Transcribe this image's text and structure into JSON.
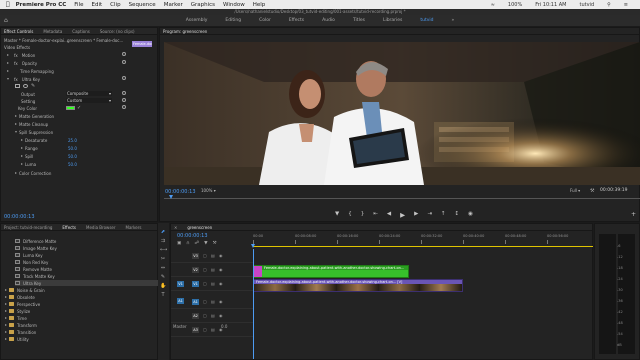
{
  "menubar": {
    "app": "Premiere Pro CC",
    "items": [
      "File",
      "Edit",
      "Clip",
      "Sequence",
      "Marker",
      "Graphics",
      "Window",
      "Help"
    ],
    "status": [
      "100%",
      "Fri 10:11 AM",
      "tutvid"
    ]
  },
  "titlebar": "/Users/nathanielstudio/Desktop/03_tutvid-editing/001-assets/tutvid-recording.prproj *",
  "workspaces": {
    "items": [
      "Assembly",
      "Editing",
      "Color",
      "Effects",
      "Audio",
      "Titles",
      "Libraries",
      "tutvid"
    ],
    "active": "tutvid"
  },
  "effect_controls": {
    "tabs": [
      "Effect Controls",
      "Metadata",
      "Captions",
      "Source: (no clips)"
    ],
    "master": "Master * Female-doctor-explai...",
    "clip": "greenscreen * Female-doc...",
    "clip_badge": "Female-doc",
    "section": "Video Effects",
    "fx": [
      "Motion",
      "Opacity",
      "Time Remapping",
      "Ultra Key"
    ],
    "output_label": "Output",
    "output_value": "Composite",
    "setting_label": "Setting",
    "setting_value": "Custom",
    "keycolor_label": "Key Color",
    "groups": [
      "Matte Generation",
      "Matte Cleanup",
      "Spill Suppression"
    ],
    "params": [
      {
        "label": "Desaturate",
        "value": "25.0"
      },
      {
        "label": "Range",
        "value": "50.0"
      },
      {
        "label": "Spill",
        "value": "50.0"
      },
      {
        "label": "Luma",
        "value": "50.0"
      }
    ],
    "color_correction": "Color Correction",
    "timecode": "00:00:00:13",
    "key_color": "#33ff22"
  },
  "program": {
    "title": "Program: greenscreen",
    "timecode": "00:00:00:13",
    "fit": "100%",
    "quality": "Full",
    "duration": "00:00:39:19"
  },
  "project": {
    "tabs": [
      "Project: tutvid-recording",
      "Effects",
      "Media Browser",
      "Markers"
    ],
    "items": [
      {
        "name": "Difference Matte",
        "kind": "fx"
      },
      {
        "name": "Image Matte Key",
        "kind": "fx"
      },
      {
        "name": "Luma Key",
        "kind": "fx"
      },
      {
        "name": "Non Red Key",
        "kind": "fx"
      },
      {
        "name": "Remove Matte",
        "kind": "fx"
      },
      {
        "name": "Track Matte Key",
        "kind": "fx"
      },
      {
        "name": "Ultra Key",
        "kind": "fx-selected"
      },
      {
        "name": "Noise & Grain",
        "kind": "folder"
      },
      {
        "name": "Obsolete",
        "kind": "folder"
      },
      {
        "name": "Perspective",
        "kind": "folder"
      },
      {
        "name": "Stylize",
        "kind": "folder"
      },
      {
        "name": "Time",
        "kind": "folder"
      },
      {
        "name": "Transform",
        "kind": "folder"
      },
      {
        "name": "Transition",
        "kind": "folder"
      },
      {
        "name": "Utility",
        "kind": "folder"
      }
    ]
  },
  "timeline": {
    "tab": "greenscreen",
    "timecode": "00:00:00:13",
    "ruler": [
      "00:00",
      "00:00:08:00",
      "00:00:16:00",
      "00:00:24:00",
      "00:00:32:00",
      "00:00:40:00",
      "00:00:48:00",
      "00:00:56:00"
    ],
    "tracks": [
      "V3",
      "V2",
      "V1",
      "A1",
      "A2",
      "A3"
    ],
    "clip_v2": "Female-doctor-explaining-about-patient-with-another-doctor-showing-chart-on...",
    "clip_v1": "Female-doctor-explaining-about-patient-with-another-doctor-showing-chart-on... [V]",
    "master_label": "0.0",
    "source_label": "V1",
    "audio_a1": "A1"
  },
  "meter": {
    "labels": [
      "-6",
      "-12",
      "-18",
      "-24",
      "-30",
      "-36",
      "-42",
      "-48",
      "-54",
      "dB"
    ]
  },
  "colors": {
    "accent": "#4d9bf2",
    "green_clip": "#37c02b",
    "audio_clip": "#2c8fb0",
    "playhead": "#4d9bf2"
  }
}
